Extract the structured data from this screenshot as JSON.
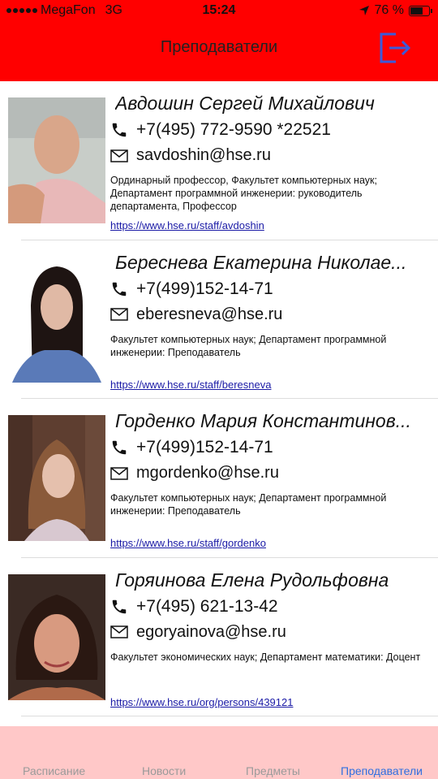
{
  "status_bar": {
    "carrier": "MegaFon",
    "network": "3G",
    "time": "15:24",
    "battery": "76 %",
    "battery_level": 0.76
  },
  "nav": {
    "title": "Преподаватели",
    "logout_icon": "logout-icon"
  },
  "teachers": [
    {
      "name": "Авдошин Сергей Михайлович",
      "phone": "+7(495) 772-9590 *22521",
      "email": "savdoshin@hse.ru",
      "description": "Ординарный профессор, Факультет компьютерных наук; Департамент программной инженерии: руководитель департамента, Профессор",
      "url": "https://www.hse.ru/staff/avdoshin"
    },
    {
      "name": "Береснева Екатерина Николае...",
      "phone": "+7(499)152-14-71",
      "email": "eberesneva@hse.ru",
      "description": "Факультет компьютерных наук; Департамент программной инженерии: Преподаватель",
      "url": "https://www.hse.ru/staff/beresneva"
    },
    {
      "name": "Горденко Мария Константинов...",
      "phone": "+7(499)152-14-71",
      "email": "mgordenko@hse.ru",
      "description": "Факультет компьютерных наук; Департамент программной инженерии: Преподаватель",
      "url": "https://www.hse.ru/staff/gordenko"
    },
    {
      "name": "Горяинова Елена Рудольфовна",
      "phone": "+7(495) 621-13-42",
      "email": "egoryainova@hse.ru",
      "description": "Факультет экономических наук; Департамент математики: Доцент",
      "url": "https://www.hse.ru/org/persons/439121"
    }
  ],
  "tabs": [
    {
      "label": "Расписание"
    },
    {
      "label": "Новости"
    },
    {
      "label": "Предметы"
    },
    {
      "label": "Преподаватели"
    }
  ],
  "colors": {
    "header": "#ff0000",
    "tabbar": "#ffc8c8",
    "active_tab": "#2f6fe0",
    "link": "#1a1aa6"
  }
}
